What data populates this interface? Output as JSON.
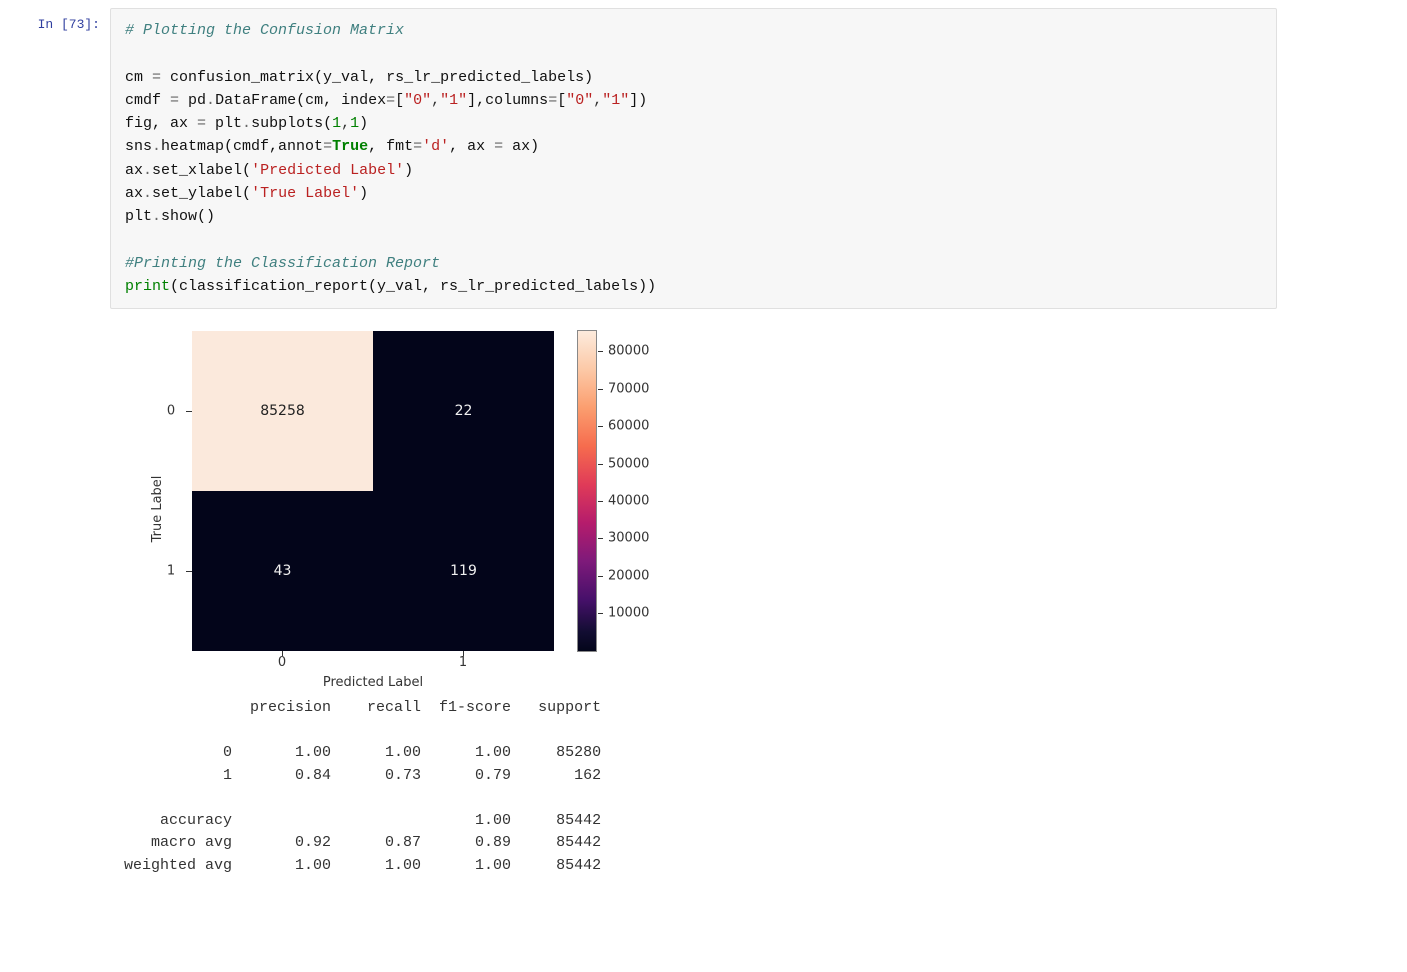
{
  "prompt": "In [73]:",
  "code": {
    "c1": "# Plotting the Confusion Matrix",
    "l1a": "cm ",
    "l1b": " confusion_matrix(y_val, rs_lr_predicted_labels)",
    "l2a": "cmdf ",
    "l2b": " pd",
    "l2c": "DataFrame(cm, index",
    "l2d": "[",
    "l2s1": "\"0\"",
    "l2s2": "\"1\"",
    "l2e": "],columns",
    "l2f": "[",
    "l2g": "])",
    "l3a": "fig, ax ",
    "l3b": " plt",
    "l3c": "subplots(",
    "l3n1": "1",
    "l3n2": "1",
    "l3d": ")",
    "l4a": "sns",
    "l4b": "heatmap(cmdf,annot",
    "l4kw": "True",
    "l4c": ", fmt",
    "l4s": "'d'",
    "l4d": ", ax ",
    "l4e": " ax)",
    "l5a": "ax",
    "l5b": "set_xlabel(",
    "l5s": "'Predicted Label'",
    "l5c": ")",
    "l6a": "ax",
    "l6b": "set_ylabel(",
    "l6s": "'True Label'",
    "l6c": ")",
    "l7a": "plt",
    "l7b": "show()",
    "c2": "#Printing the Classification Report",
    "l8a": "print",
    "l8b": "(classification_report(y_val, rs_lr_predicted_labels))"
  },
  "chart_data": {
    "type": "heatmap",
    "xlabel": "Predicted Label",
    "ylabel": "True Label",
    "xticks": [
      "0",
      "1"
    ],
    "yticks": [
      "0",
      "1"
    ],
    "matrix": [
      [
        85258,
        22
      ],
      [
        43,
        119
      ]
    ],
    "colorbar_ticks": [
      80000,
      70000,
      60000,
      50000,
      40000,
      30000,
      20000,
      10000
    ],
    "colorbar_range": [
      0,
      85258
    ]
  },
  "cm": {
    "c00": "85258",
    "c01": "22",
    "c10": "43",
    "c11": "119"
  },
  "axes": {
    "y0": "0",
    "y1": "1",
    "x0": "0",
    "x1": "1",
    "ylabel": "True Label",
    "xlabel": "Predicted Label"
  },
  "cbar": {
    "t80": "80000",
    "t70": "70000",
    "t60": "60000",
    "t50": "50000",
    "t40": "40000",
    "t30": "30000",
    "t20": "20000",
    "t10": "10000"
  },
  "report": {
    "header": "              precision    recall  f1-score   support",
    "r0": "           0       1.00      1.00      1.00     85280",
    "r1": "           1       0.84      0.73      0.79       162",
    "acc": "    accuracy                           1.00     85442",
    "macro": "   macro avg       0.92      0.87      0.89     85442",
    "wavg": "weighted avg       1.00      1.00      1.00     85442"
  }
}
